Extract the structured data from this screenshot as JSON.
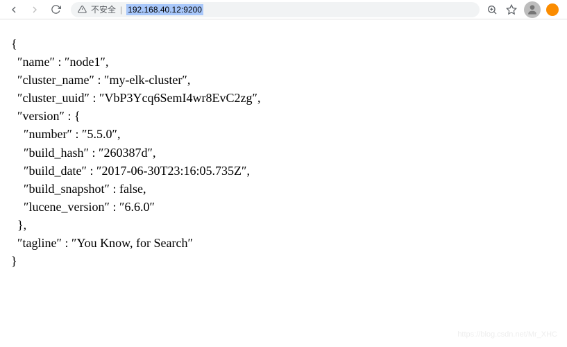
{
  "toolbar": {
    "security_label": "不安全",
    "url": "192.168.40.12:9200"
  },
  "response": {
    "name": "node1",
    "cluster_name": "my-elk-cluster",
    "cluster_uuid": "VbP3Ycq6SemI4wr8EvC2zg",
    "version": {
      "number": "5.5.0",
      "build_hash": "260387d",
      "build_date": "2017-06-30T23:16:05.735Z",
      "build_snapshot": "false",
      "lucene_version": "6.6.0"
    },
    "tagline": "You Know, for Search"
  },
  "watermark": "https://blog.csdn.net/Mr_XHC"
}
